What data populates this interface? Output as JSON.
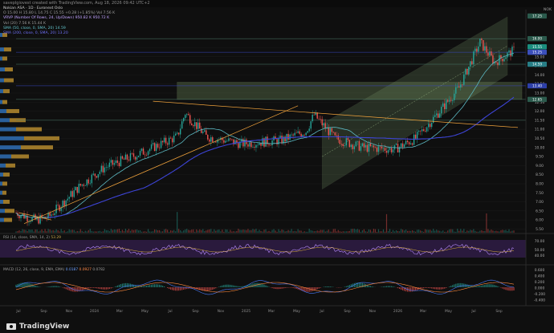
{
  "header": {
    "credit": "saveplgiovest created with TradingView.com, Aug 18, 2026 09:42 UTC+2"
  },
  "legend": {
    "symbol_line": "Nokian ASA · 1D · Euronext Oslo",
    "ohlc": "O 15.00  H 15.80  L 14.75  C 15.55  +0.28 (+1.85%)  Vol 7.56 K",
    "vrvp": "VRVP (Number Of Rows, 24, Up/Down)  950.82 K  950.72 K",
    "vol": "Vol (20)  7.56 K  15.44 K",
    "sma50": "SMA (50, close, 0, SMA, 20)  14.59",
    "sma200": "SMA (200, close, 0, SMA, 20)  13.20"
  },
  "currency": "NOK",
  "price_axis": {
    "labels": [
      "16.00",
      "15.50",
      "15.00",
      "14.50",
      "14.00",
      "13.50",
      "13.00",
      "12.50",
      "12.00",
      "11.50",
      "11.00",
      "10.50",
      "10.00",
      "9.50",
      "9.00",
      "8.50",
      "8.00",
      "7.50",
      "7.00",
      "6.50",
      "6.00",
      "5.50"
    ],
    "tags": [
      {
        "text": "17.25",
        "price": 17.25,
        "color": "#2b5a4c"
      },
      {
        "text": "16.00",
        "price": 16.0,
        "color": "#2b5a4c"
      },
      {
        "text": "15.55",
        "price": 15.55,
        "color": "#1a8f7f"
      },
      {
        "text": "15.25",
        "price": 15.25,
        "color": "#3b4fbb"
      },
      {
        "text": "14.59",
        "price": 14.59,
        "color": "#277e86"
      },
      {
        "text": "13.40",
        "price": 13.4,
        "color": "#2d3fa8"
      },
      {
        "text": "12.65",
        "price": 12.65,
        "color": "#2b5a4c"
      }
    ]
  },
  "time_axis": [
    "Jul",
    "Sep",
    "Nov",
    "2024",
    "Mar",
    "May",
    "Jul",
    "Sep",
    "Nov",
    "2025",
    "Mar",
    "May",
    "Jul",
    "Sep",
    "Nov",
    "2026",
    "Mar",
    "May",
    "Jul",
    "Sep"
  ],
  "rsi": {
    "label": "RSI (14, close, SMA, 14, 2)",
    "value": "53.29",
    "axis": [
      "70.00",
      "50.00",
      "40.00"
    ]
  },
  "macd": {
    "label": "MACD (12, 26, close, 9, EMA, EMA)",
    "v1": "0.0187",
    "v2": "0.0927",
    "v3": "0.0782",
    "axis": [
      "0.600",
      "0.400",
      "0.200",
      "0.000",
      "-0.200",
      "-0.400"
    ]
  },
  "watermark": "TradingView",
  "colors": {
    "up": "#26a69a",
    "down": "#ef5350",
    "sma50": "#5cb8c2",
    "sma200": "#3d44d6",
    "trend": "#f1a33c",
    "channel": "#7fa06f"
  }
}
